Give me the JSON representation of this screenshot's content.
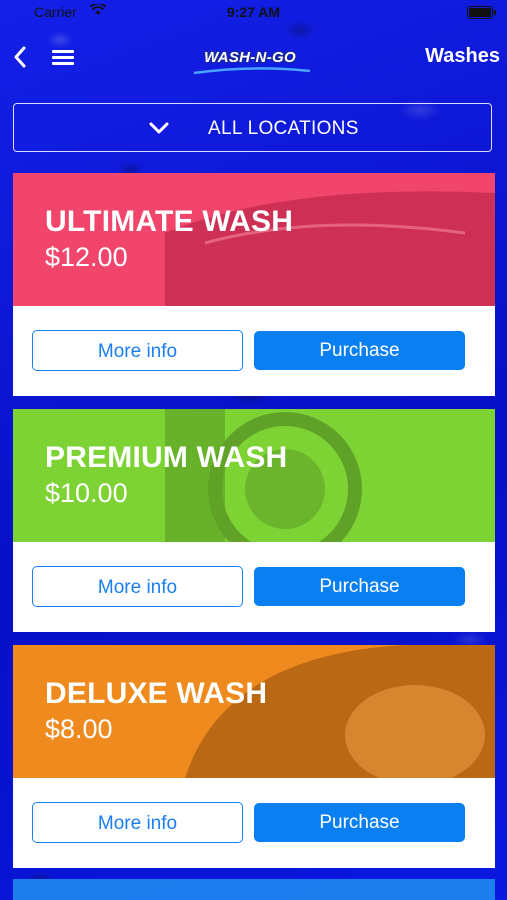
{
  "status_bar": {
    "carrier": "Carrier",
    "time": "9:27 AM"
  },
  "nav": {
    "logo_text": "WASH-N-GO",
    "title": "Washes",
    "icons": {
      "back": "chevron-left-icon",
      "menu": "hamburger-menu-icon"
    }
  },
  "location_filter": {
    "label": "ALL LOCATIONS",
    "icon": "chevron-down-icon"
  },
  "washes": [
    {
      "name": "ULTIMATE WASH",
      "price": "$12.00",
      "color": "#f2456b",
      "more_label": "More info",
      "purchase_label": "Purchase"
    },
    {
      "name": "PREMIUM WASH",
      "price": "$10.00",
      "color": "#7dd334",
      "more_label": "More info",
      "purchase_label": "Purchase"
    },
    {
      "name": "DELUXE WASH",
      "price": "$8.00",
      "color": "#ef8a1e",
      "more_label": "More info",
      "purchase_label": "Purchase"
    }
  ],
  "colors": {
    "button_primary": "#0a7ff2",
    "background": "#0a16d8"
  }
}
